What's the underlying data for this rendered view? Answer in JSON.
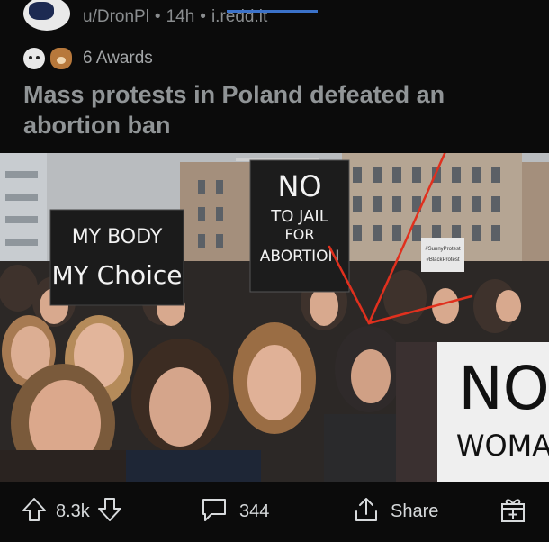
{
  "post": {
    "author": "u/DronPl",
    "separator": "•",
    "age": "14h",
    "domain": "i.redd.it",
    "awards_label": "6 Awards",
    "title": "Mass protests in Poland defeated an abortion ban"
  },
  "image": {
    "signs": {
      "my_body": "MY BODY",
      "my_choice": "MY Choice",
      "no": "NO",
      "to_jail": "TO JAIL",
      "for": "FOR",
      "abortion": "ABORTION",
      "small_sign_1": "#SunnyProtest",
      "small_sign_2": "#BlackProtest",
      "right_sign_1": "NO",
      "right_sign_2": "WOMA"
    }
  },
  "actions": {
    "upvotes": "8.3k",
    "comments": "344",
    "share_label": "Share"
  },
  "icons": {
    "upvote": "upvote-arrow-icon",
    "downvote": "downvote-arrow-icon",
    "comment": "comment-bubble-icon",
    "share": "share-icon",
    "award": "gift-award-icon"
  },
  "colors": {
    "background": "#0b0b0b",
    "text_muted": "#8a8d8f",
    "domain_underline": "#3b72c9",
    "annotation_red": "#e0301e"
  }
}
